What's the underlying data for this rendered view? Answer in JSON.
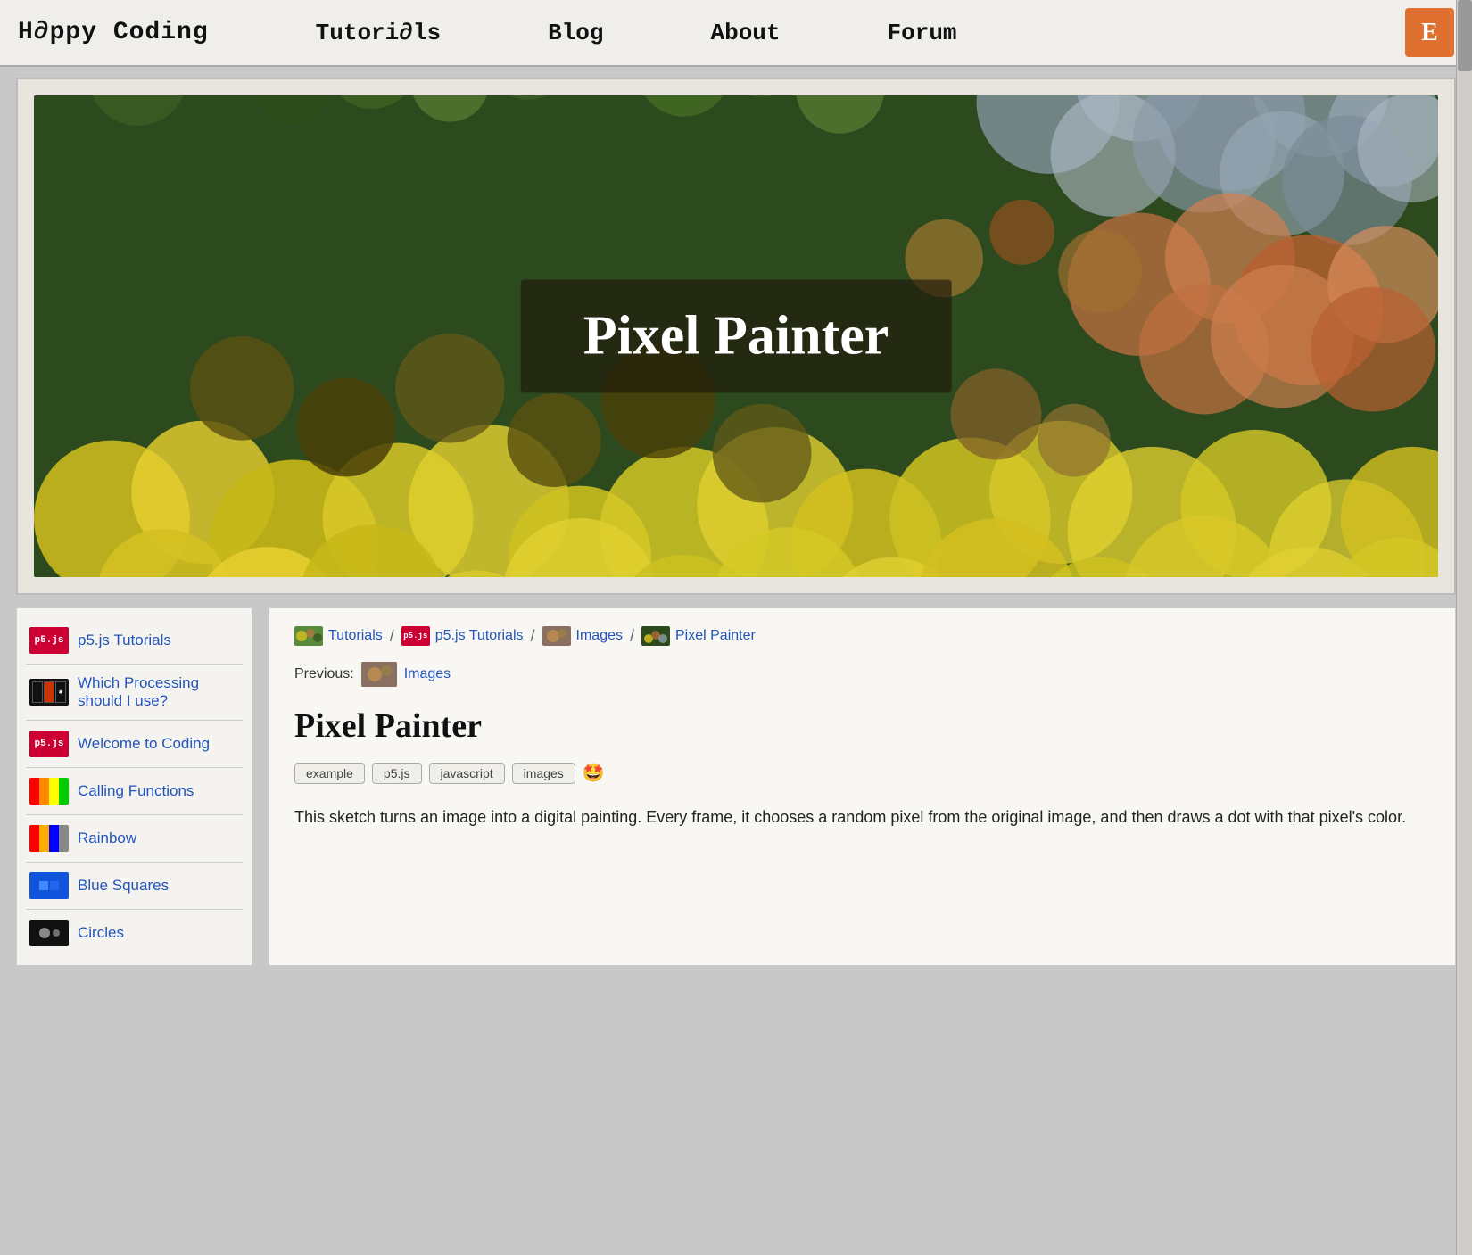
{
  "nav": {
    "logo": "H∂ppy Coding",
    "links": [
      "Tutori∂ls",
      "Blog",
      "About",
      "Forum"
    ],
    "icon_label": "E",
    "icon_color": "#e07030"
  },
  "hero": {
    "title": "Pixel Painter"
  },
  "sidebar": {
    "items": [
      {
        "id": "p5js-tutorials",
        "icon_type": "p5js",
        "label": "p5.js Tutorials"
      },
      {
        "id": "which-processing",
        "icon_type": "which",
        "label": "Which Processing should I use?"
      },
      {
        "id": "welcome-to-coding",
        "icon_type": "p5js",
        "label": "Welcome to Coding"
      },
      {
        "id": "calling-functions",
        "icon_type": "calling",
        "label": "Calling Functions"
      },
      {
        "id": "rainbow",
        "icon_type": "rainbow",
        "label": "Rainbow"
      },
      {
        "id": "blue-squares",
        "icon_type": "bluesquares",
        "label": "Blue Squares"
      },
      {
        "id": "circles",
        "icon_type": "circles",
        "label": "Circles"
      }
    ]
  },
  "breadcrumb": {
    "items": [
      {
        "id": "tutorials",
        "label": "Tutorials",
        "icon_type": "tutorials"
      },
      {
        "id": "p5js-tutorials",
        "label": "p5.js Tutorials",
        "icon_type": "p5js"
      },
      {
        "id": "images",
        "label": "Images",
        "icon_type": "images"
      },
      {
        "id": "pixel-painter",
        "label": "Pixel Painter",
        "icon_type": "pixel-painter"
      }
    ]
  },
  "previous": {
    "label": "Previous:",
    "link_label": "Images",
    "icon_type": "images"
  },
  "content": {
    "title": "Pixel Painter",
    "tags": [
      "example",
      "p5.js",
      "javascript",
      "images"
    ],
    "tag_emoji": "🤩",
    "description": "This sketch turns an image into a digital painting. Every frame, it chooses a random pixel from the original image, and then draws a dot with that pixel's color."
  }
}
